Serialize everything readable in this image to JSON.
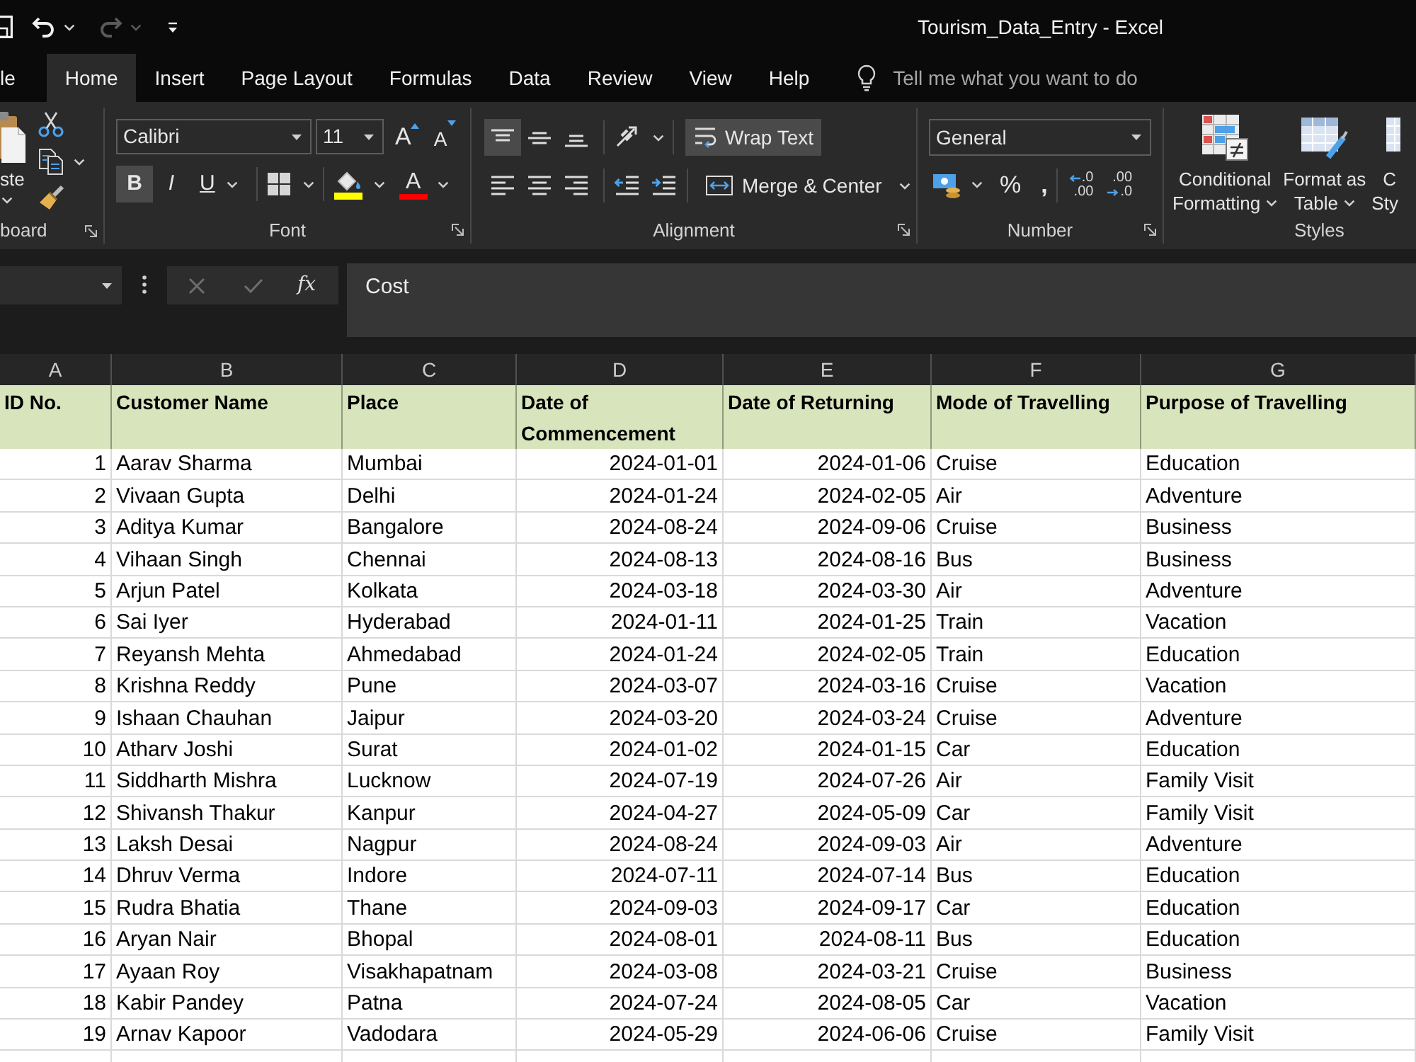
{
  "quick_access": {
    "redo": {
      "disabled": true
    }
  },
  "window": {
    "title": "Tourism_Data_Entry - Excel"
  },
  "tabs": [
    {
      "label": "le",
      "selected": false
    },
    {
      "label": "Home",
      "selected": true
    },
    {
      "label": "Insert",
      "selected": false
    },
    {
      "label": "Page Layout",
      "selected": false
    },
    {
      "label": "Formulas",
      "selected": false
    },
    {
      "label": "Data",
      "selected": false
    },
    {
      "label": "Review",
      "selected": false
    },
    {
      "label": "View",
      "selected": false
    },
    {
      "label": "Help",
      "selected": false
    }
  ],
  "tell_me": {
    "placeholder": "Tell me what you want to do"
  },
  "ribbon": {
    "clipboard": {
      "label": "board",
      "paste": "ste"
    },
    "font": {
      "label": "Font",
      "font_name": "Calibri",
      "font_size": "11",
      "grow": "A",
      "shrink": "A",
      "toggles": [
        {
          "kind": "bold",
          "text": "B",
          "selected": true
        },
        {
          "kind": "italic",
          "text": "I",
          "selected": false
        },
        {
          "kind": "underline",
          "text": "U",
          "selected": false
        }
      ],
      "font_color": "A"
    },
    "alignment": {
      "label": "Alignment",
      "vertical": [
        {
          "kind": "top",
          "selected": true
        },
        {
          "kind": "middle",
          "selected": false
        },
        {
          "kind": "bottom",
          "selected": false
        }
      ],
      "horizontal": [
        {
          "kind": "left",
          "selected": false
        },
        {
          "kind": "center",
          "selected": false
        },
        {
          "kind": "right",
          "selected": false
        }
      ],
      "wrap_text": {
        "label": "Wrap Text",
        "selected": true
      },
      "merge": "Merge & Center"
    },
    "number": {
      "label": "Number",
      "format": "General",
      "percent": "%",
      "comma": ",",
      "increase_decimal": [
        ".0",
        ".00"
      ],
      "decrease_decimal": [
        ".00",
        ".0"
      ]
    },
    "styles": {
      "label": "Styles",
      "buttons": [
        {
          "kind": "conditional_formatting",
          "lines": [
            "Conditional",
            "Formatting"
          ],
          "dropdown": true
        },
        {
          "kind": "format_as_table",
          "lines": [
            "Format as",
            "Table"
          ],
          "dropdown": true
        },
        {
          "kind": "cell_styles",
          "lines": [
            "C",
            "Sty"
          ],
          "dropdown": false
        }
      ]
    }
  },
  "formula_bar": {
    "function": "fx",
    "value": "Cost"
  },
  "sheet": {
    "column_headers": [
      "A",
      "B",
      "C",
      "D",
      "E",
      "F",
      "G"
    ],
    "header": [
      "ID No.",
      "Customer Name",
      "Place",
      "Date of Commencement",
      "Date of Returning",
      "Mode of Travelling",
      "Purpose of Travelling"
    ],
    "rows": [
      [
        "1",
        "Aarav Sharma",
        "Mumbai",
        "2024-01-01",
        "2024-01-06",
        "Cruise",
        "Education"
      ],
      [
        "2",
        "Vivaan Gupta",
        "Delhi",
        "2024-01-24",
        "2024-02-05",
        "Air",
        "Adventure"
      ],
      [
        "3",
        "Aditya Kumar",
        "Bangalore",
        "2024-08-24",
        "2024-09-06",
        "Cruise",
        "Business"
      ],
      [
        "4",
        "Vihaan Singh",
        "Chennai",
        "2024-08-13",
        "2024-08-16",
        "Bus",
        "Business"
      ],
      [
        "5",
        "Arjun Patel",
        "Kolkata",
        "2024-03-18",
        "2024-03-30",
        "Air",
        "Adventure"
      ],
      [
        "6",
        "Sai Iyer",
        "Hyderabad",
        "2024-01-11",
        "2024-01-25",
        "Train",
        "Vacation"
      ],
      [
        "7",
        "Reyansh Mehta",
        "Ahmedabad",
        "2024-01-24",
        "2024-02-05",
        "Train",
        "Education"
      ],
      [
        "8",
        "Krishna Reddy",
        "Pune",
        "2024-03-07",
        "2024-03-16",
        "Cruise",
        "Vacation"
      ],
      [
        "9",
        "Ishaan Chauhan",
        "Jaipur",
        "2024-03-20",
        "2024-03-24",
        "Cruise",
        "Adventure"
      ],
      [
        "10",
        "Atharv Joshi",
        "Surat",
        "2024-01-02",
        "2024-01-15",
        "Car",
        "Education"
      ],
      [
        "11",
        "Siddharth Mishra",
        "Lucknow",
        "2024-07-19",
        "2024-07-26",
        "Air",
        "Family Visit"
      ],
      [
        "12",
        "Shivansh Thakur",
        "Kanpur",
        "2024-04-27",
        "2024-05-09",
        "Car",
        "Family Visit"
      ],
      [
        "13",
        "Laksh Desai",
        "Nagpur",
        "2024-08-24",
        "2024-09-03",
        "Air",
        "Adventure"
      ],
      [
        "14",
        "Dhruv Verma",
        "Indore",
        "2024-07-11",
        "2024-07-14",
        "Bus",
        "Education"
      ],
      [
        "15",
        "Rudra Bhatia",
        "Thane",
        "2024-09-03",
        "2024-09-17",
        "Car",
        "Education"
      ],
      [
        "16",
        "Aryan Nair",
        "Bhopal",
        "2024-08-01",
        "2024-08-11",
        "Bus",
        "Education"
      ],
      [
        "17",
        "Ayaan Roy",
        "Visakhapatnam",
        "2024-03-08",
        "2024-03-21",
        "Cruise",
        "Business"
      ],
      [
        "18",
        "Kabir Pandey",
        "Patna",
        "2024-07-24",
        "2024-08-05",
        "Car",
        "Vacation"
      ],
      [
        "19",
        "Arnav Kapoor",
        "Vadodara",
        "2024-05-29",
        "2024-06-06",
        "Cruise",
        "Family Visit"
      ]
    ]
  }
}
